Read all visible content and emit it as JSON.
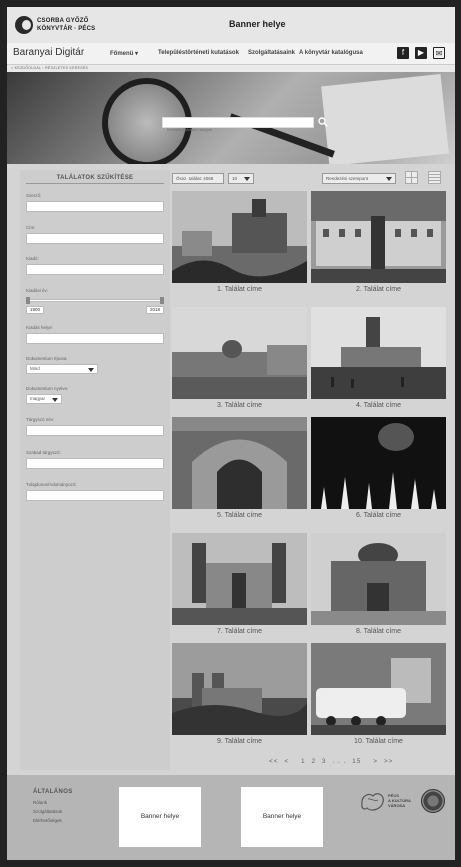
{
  "header": {
    "logo_line1": "CSORBA GYŐZŐ",
    "logo_line2": "KÖNYVTÁR · PÉCS",
    "banner": "Banner helye"
  },
  "nav": {
    "brand": "Baranyai Digitár",
    "items": [
      "Főmenü ▾",
      "Településtörténeti kutatások",
      "Szolgáltatásaink",
      "A könyvtár katalógusa"
    ],
    "icons": [
      "facebook-icon",
      "youtube-icon",
      "mail-icon",
      "share-icon"
    ]
  },
  "breadcrumb": "⌂ KEZDŐOLDAL › RÉSZLETES KERESÉS",
  "search": {
    "placeholder": "Keresés kulcsszó alapján"
  },
  "sidebar": {
    "title": "TALÁLATOK SZŰKÍTÉSE",
    "labels": {
      "author": "Szerző:",
      "title": "Cím:",
      "publisher": "Kiadó:",
      "year": "Kiadási év:",
      "place": "Kiadás helye:",
      "doctype": "Dokumentum típusa:",
      "language": "Dokumentum nyelve:",
      "person": "Tárgyszó név:",
      "free": "Szabad tárgyszó:",
      "owner": "Tulajdonos/Adományozó:"
    },
    "doctype_value": "Mind",
    "language_value": "magyar",
    "year_from": "1900",
    "year_to": "2018",
    "year_range_fraction": [
      0.0,
      1.0
    ]
  },
  "toolbar": {
    "total": "Össz. találat: 4068",
    "per_page": "10",
    "sort": "Rendezési szempont"
  },
  "results": [
    {
      "title": "1. Találat címe"
    },
    {
      "title": "2. Találat címe"
    },
    {
      "title": "3. Találat címe"
    },
    {
      "title": "4. Találat címe"
    },
    {
      "title": "5. Találat címe"
    },
    {
      "title": "6. Találat címe"
    },
    {
      "title": "7. Találat címe"
    },
    {
      "title": "8. Találat címe"
    },
    {
      "title": "9. Találat címe"
    },
    {
      "title": "10. Találat címe"
    }
  ],
  "pager": [
    "<<",
    "<",
    "1",
    "2",
    "3",
    ". . .",
    "15",
    ">",
    ">>"
  ],
  "footer": {
    "heading": "ÁLTALÁNOS",
    "links": [
      "Rólunk",
      "Szolgáltatások",
      "Elérhetőségek"
    ],
    "banner1": "Banner helye",
    "banner2": "Banner helye",
    "city_logo": [
      "PÉCS",
      "A KULTÚRA",
      "VÁROSA"
    ]
  }
}
